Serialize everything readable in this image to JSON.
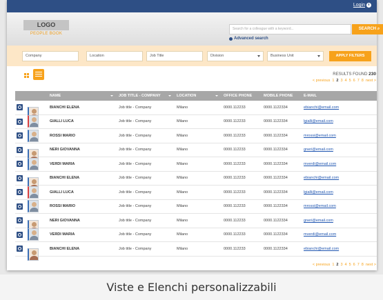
{
  "topbar": {
    "login_label": "Login"
  },
  "header": {
    "logo_text": "LOGO",
    "logo_subtitle": "PEOPLE BOOK",
    "search_placeholder": "Search for a colleague with a keyword...",
    "search_button": "SEARCH",
    "advanced_search": "Advanced search"
  },
  "filters": {
    "company": "Company",
    "location": "Location",
    "job_title": "Job Title",
    "division": "Division",
    "business_unit": "Business Unit",
    "apply_button": "APPLY FILTERS"
  },
  "results": {
    "label": "RESULTS FOUND",
    "count": "230"
  },
  "pagination": {
    "previous": "< previous",
    "pages": [
      "1",
      "2",
      "3",
      "4",
      "5",
      "6",
      "7",
      "8"
    ],
    "next": "next >"
  },
  "table": {
    "columns": [
      "NAME",
      "JOB TITLE - COMPANY",
      "LOCATION",
      "OFFICE PHONE",
      "MOBILE PHONE",
      "E-MAIL"
    ],
    "rows": [
      {
        "name": "BIANCHI ELENA",
        "job": "Job title - Company",
        "location": "Milano",
        "office": "0000.112233",
        "mobile": "0000.1122334",
        "email": "ebianchi@email.com",
        "gender": "f"
      },
      {
        "name": "GIALLI LUCA",
        "job": "Job title - Company",
        "location": "Milano",
        "office": "0000.112233",
        "mobile": "0000.1122334",
        "email": "lgialli@email.com",
        "gender": "m"
      },
      {
        "name": "ROSSI MARIO",
        "job": "Job title - Company",
        "location": "Milano",
        "office": "0000.112233",
        "mobile": "0000.1122334",
        "email": "mrossi@email.com",
        "gender": "m"
      },
      {
        "name": "NERI GIOVANNA",
        "job": "Job title - Company",
        "location": "Milano",
        "office": "0000.112233",
        "mobile": "0000.1122334",
        "email": "gneri@email.com",
        "gender": "f"
      },
      {
        "name": "VERDI MARIA",
        "job": "Job title - Company",
        "location": "Milano",
        "office": "0000.112233",
        "mobile": "0000.1122334",
        "email": "mverdi@email.com",
        "gender": "m"
      },
      {
        "name": "BIANCHI ELENA",
        "job": "Job title - Company",
        "location": "Milano",
        "office": "0000.112233",
        "mobile": "0000.1122334",
        "email": "ebianchi@email.com",
        "gender": "f"
      },
      {
        "name": "GIALLI LUCA",
        "job": "Job title - Company",
        "location": "Milano",
        "office": "0000.112233",
        "mobile": "0000.1122334",
        "email": "lgialli@email.com",
        "gender": "m"
      },
      {
        "name": "ROSSI MARIO",
        "job": "Job title - Company",
        "location": "Milano",
        "office": "0000.112233",
        "mobile": "0000.1122334",
        "email": "mrossi@email.com",
        "gender": "m"
      },
      {
        "name": "NERI GIOVANNA",
        "job": "Job title - Company",
        "location": "Milano",
        "office": "0000.112233",
        "mobile": "0000.1122334",
        "email": "gneri@email.com",
        "gender": "f"
      },
      {
        "name": "VERDI MARIA",
        "job": "Job title - Company",
        "location": "Milano",
        "office": "0000.112233",
        "mobile": "0000.1122334",
        "email": "mverdi@email.com",
        "gender": "m"
      },
      {
        "name": "BIANCHI ELENA",
        "job": "Job title - Company",
        "location": "Milano",
        "office": "0000.112233",
        "mobile": "0000.1122334",
        "email": "ebianchi@email.com",
        "gender": "f"
      }
    ]
  },
  "caption": "Viste e Elenchi personalizzabili",
  "colors": {
    "brand_blue": "#2e4f85",
    "accent_orange": "#f7a21b",
    "filter_bg": "#fde7c7"
  }
}
